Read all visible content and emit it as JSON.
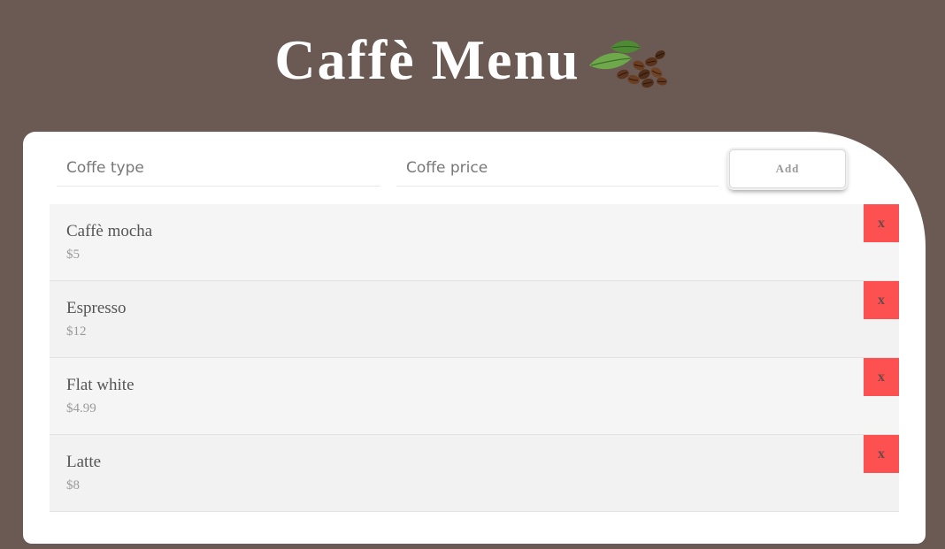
{
  "header": {
    "title": "Caffè Menu",
    "icon": "coffee-beans-icon"
  },
  "form": {
    "type_placeholder": "Coffe type",
    "price_placeholder": "Coffe price",
    "add_label": "Add"
  },
  "items": [
    {
      "name": "Caffè mocha",
      "price": "$5",
      "remove_label": "x"
    },
    {
      "name": "Espresso",
      "price": "$12",
      "remove_label": "x"
    },
    {
      "name": "Flat white",
      "price": "$4.99",
      "remove_label": "x"
    },
    {
      "name": "Latte",
      "price": "$8",
      "remove_label": "x"
    }
  ],
  "colors": {
    "background": "#6a5a53",
    "card": "#ffffff",
    "remove_button": "#fd5050"
  }
}
